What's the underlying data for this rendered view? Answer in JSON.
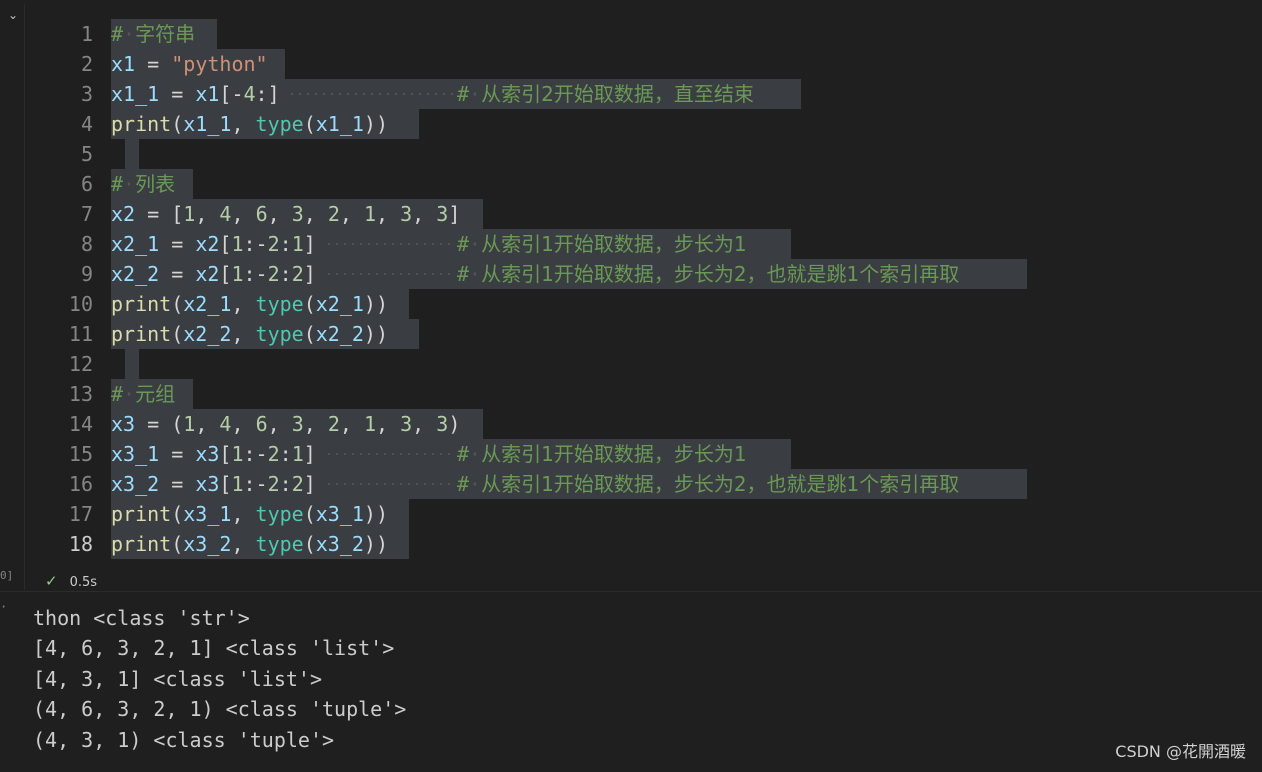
{
  "cell": {
    "collapse_icon": "chevron-down-icon",
    "execution_label": "0]",
    "status": {
      "check_icon": "check-icon",
      "check_glyph": "✓",
      "duration": "0.5s"
    }
  },
  "code_lines": [
    "# 字符串",
    "x1 = \"python\"",
    "x1_1 = x1[-4:]               # 从索引2开始取数据，直至结束",
    "print(x1_1, type(x1_1))",
    "",
    "# 列表",
    "x2 = [1, 4, 6, 3, 2, 1, 3, 3]",
    "x2_1 = x2[1:-2:1]          # 从索引1开始取数据，步长为1",
    "x2_2 = x2[1:-2:2]          # 从索引1开始取数据，步长为2，也就是跳1个索引再取",
    "print(x2_1, type(x2_1))",
    "print(x2_2, type(x2_2))",
    "",
    "# 元组",
    "x3 = (1, 4, 6, 3, 2, 1, 3, 3)",
    "x3_1 = x3[1:-2:1]          # 从索引1开始取数据，步长为1",
    "x3_2 = x3[1:-2:2]          # 从索引1开始取数据，步长为2，也就是跳1个索引再取",
    "print(x3_1, type(x3_1))",
    "print(x3_2, type(x3_2))"
  ],
  "line_numbers": [
    "1",
    "2",
    "3",
    "4",
    "5",
    "6",
    "7",
    "8",
    "9",
    "10",
    "11",
    "12",
    "13",
    "14",
    "15",
    "16",
    "17",
    "18"
  ],
  "output": {
    "marker": "·",
    "lines": [
      "thon <class 'str'>",
      "[4, 6, 3, 2, 1] <class 'list'>",
      "[4, 3, 1] <class 'list'>",
      "(4, 6, 3, 2, 1) <class 'tuple'>",
      "(4, 3, 1) <class 'tuple'>"
    ]
  },
  "watermark": "CSDN @花開酒暖",
  "colors": {
    "background": "#1f1f1f",
    "selection": "#3a3d41",
    "comment": "#6a9955",
    "variable": "#9cdcfe",
    "function": "#dcdcaa",
    "builtin_type": "#4ec9b0",
    "string": "#ce9178",
    "number": "#b5cea8"
  }
}
